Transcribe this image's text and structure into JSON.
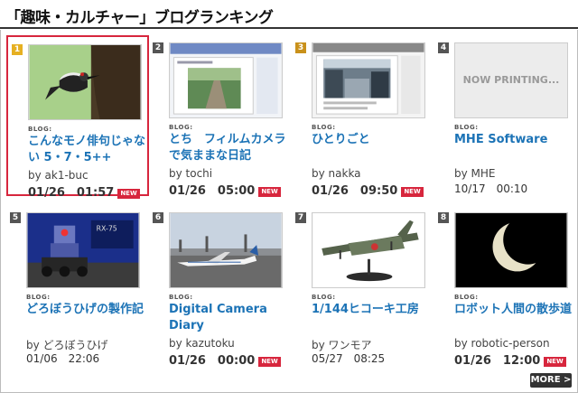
{
  "header": {
    "title": "「趣味・カルチャー」ブログランキング"
  },
  "blog_label": "BLOG:",
  "new_label": "NEW",
  "more_label": "MORE >",
  "now_printing": "NOW PRINTING...",
  "colors": {
    "link": "#1c73b6",
    "new_badge": "#d7263d",
    "rank_gold": "#e6b022",
    "rank_bronze": "#c9911b",
    "rank_default": "#555555",
    "selection": "#d7263d"
  },
  "cards": [
    {
      "rank": "1",
      "title": "こんなモノ俳句じゃない 5・7・5++",
      "author": "by ak1-buc",
      "date": "01/26　01:57",
      "new": true,
      "thumbnail": "woodpecker-photo"
    },
    {
      "rank": "2",
      "title": "とち　フィルムカメラで気ままな日記",
      "author": "by tochi",
      "date": "01/26　05:00",
      "new": true,
      "thumbnail": "blog-screenshot-path"
    },
    {
      "rank": "3",
      "title": "ひとりごと",
      "author": "by nakka",
      "date": "01/26　09:50",
      "new": true,
      "thumbnail": "blog-screenshot-station"
    },
    {
      "rank": "4",
      "title": "MHE Software",
      "author": "by MHE",
      "date": "10/17　00:10",
      "new": false,
      "thumbnail": "now-printing"
    },
    {
      "rank": "5",
      "title": "どろぼうひげの製作記",
      "author": "by どろぼうひげ",
      "date": "01/06　22:06",
      "new": false,
      "thumbnail": "robot-model-photo"
    },
    {
      "rank": "6",
      "title": "Digital Camera Diary",
      "author": "by kazutoku",
      "date": "01/26　00:00",
      "new": true,
      "thumbnail": "airport-photo"
    },
    {
      "rank": "7",
      "title": "1/144ヒコーキ工房",
      "author": "by ワンモア",
      "date": "05/27　08:25",
      "new": false,
      "thumbnail": "airplane-model-photo"
    },
    {
      "rank": "8",
      "title": "ロボット人間の散歩道",
      "author": "by robotic-person",
      "date": "01/26　12:00",
      "new": true,
      "thumbnail": "crescent-moon-photo"
    }
  ]
}
